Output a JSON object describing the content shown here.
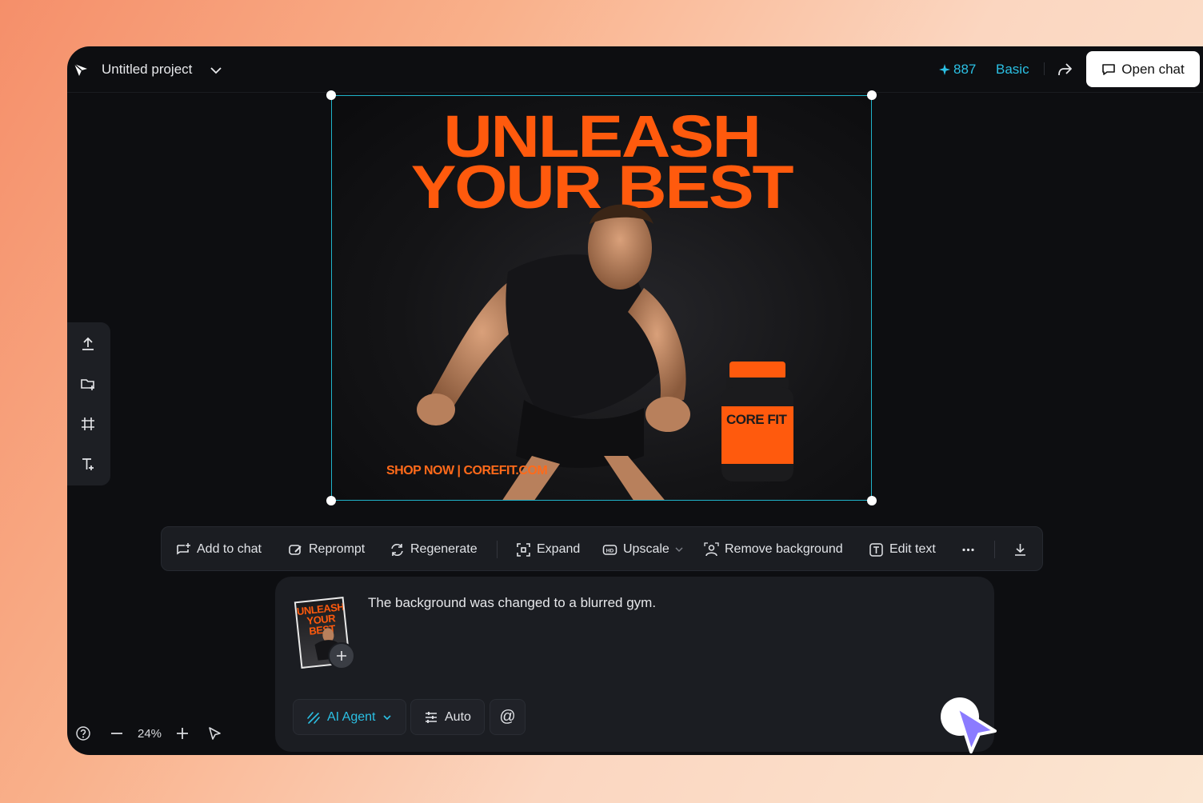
{
  "header": {
    "project_title": "Untitled project",
    "credits": "887",
    "plan": "Basic",
    "open_chat_label": "Open chat"
  },
  "poster": {
    "headline_line1": "UNLEASH",
    "headline_line2": "YOUR BEST",
    "footer_text": "SHOP NOW | COREFIT.COM",
    "product_label": "CORE FIT",
    "accent_color": "#ff5a0d"
  },
  "left_toolbar": {
    "items": [
      "upload-icon",
      "folder-add-icon",
      "crop-icon",
      "add-text-icon"
    ]
  },
  "action_bar": {
    "add_to_chat": "Add to chat",
    "reprompt": "Reprompt",
    "regenerate": "Regenerate",
    "expand": "Expand",
    "upscale": "Upscale",
    "remove_background": "Remove background",
    "edit_text": "Edit text"
  },
  "chat": {
    "thumbnail_text": "UNLEASH YOUR BEST",
    "message": "The background was changed to a blurred gym.",
    "agent_label": "AI Agent",
    "mode_label": "Auto",
    "mention_label": "@"
  },
  "zoom": {
    "level": "24%"
  },
  "colors": {
    "accent_cyan": "#2bc0e4",
    "selection": "#1fb3c9",
    "agent_purple": "#8b7bff"
  }
}
